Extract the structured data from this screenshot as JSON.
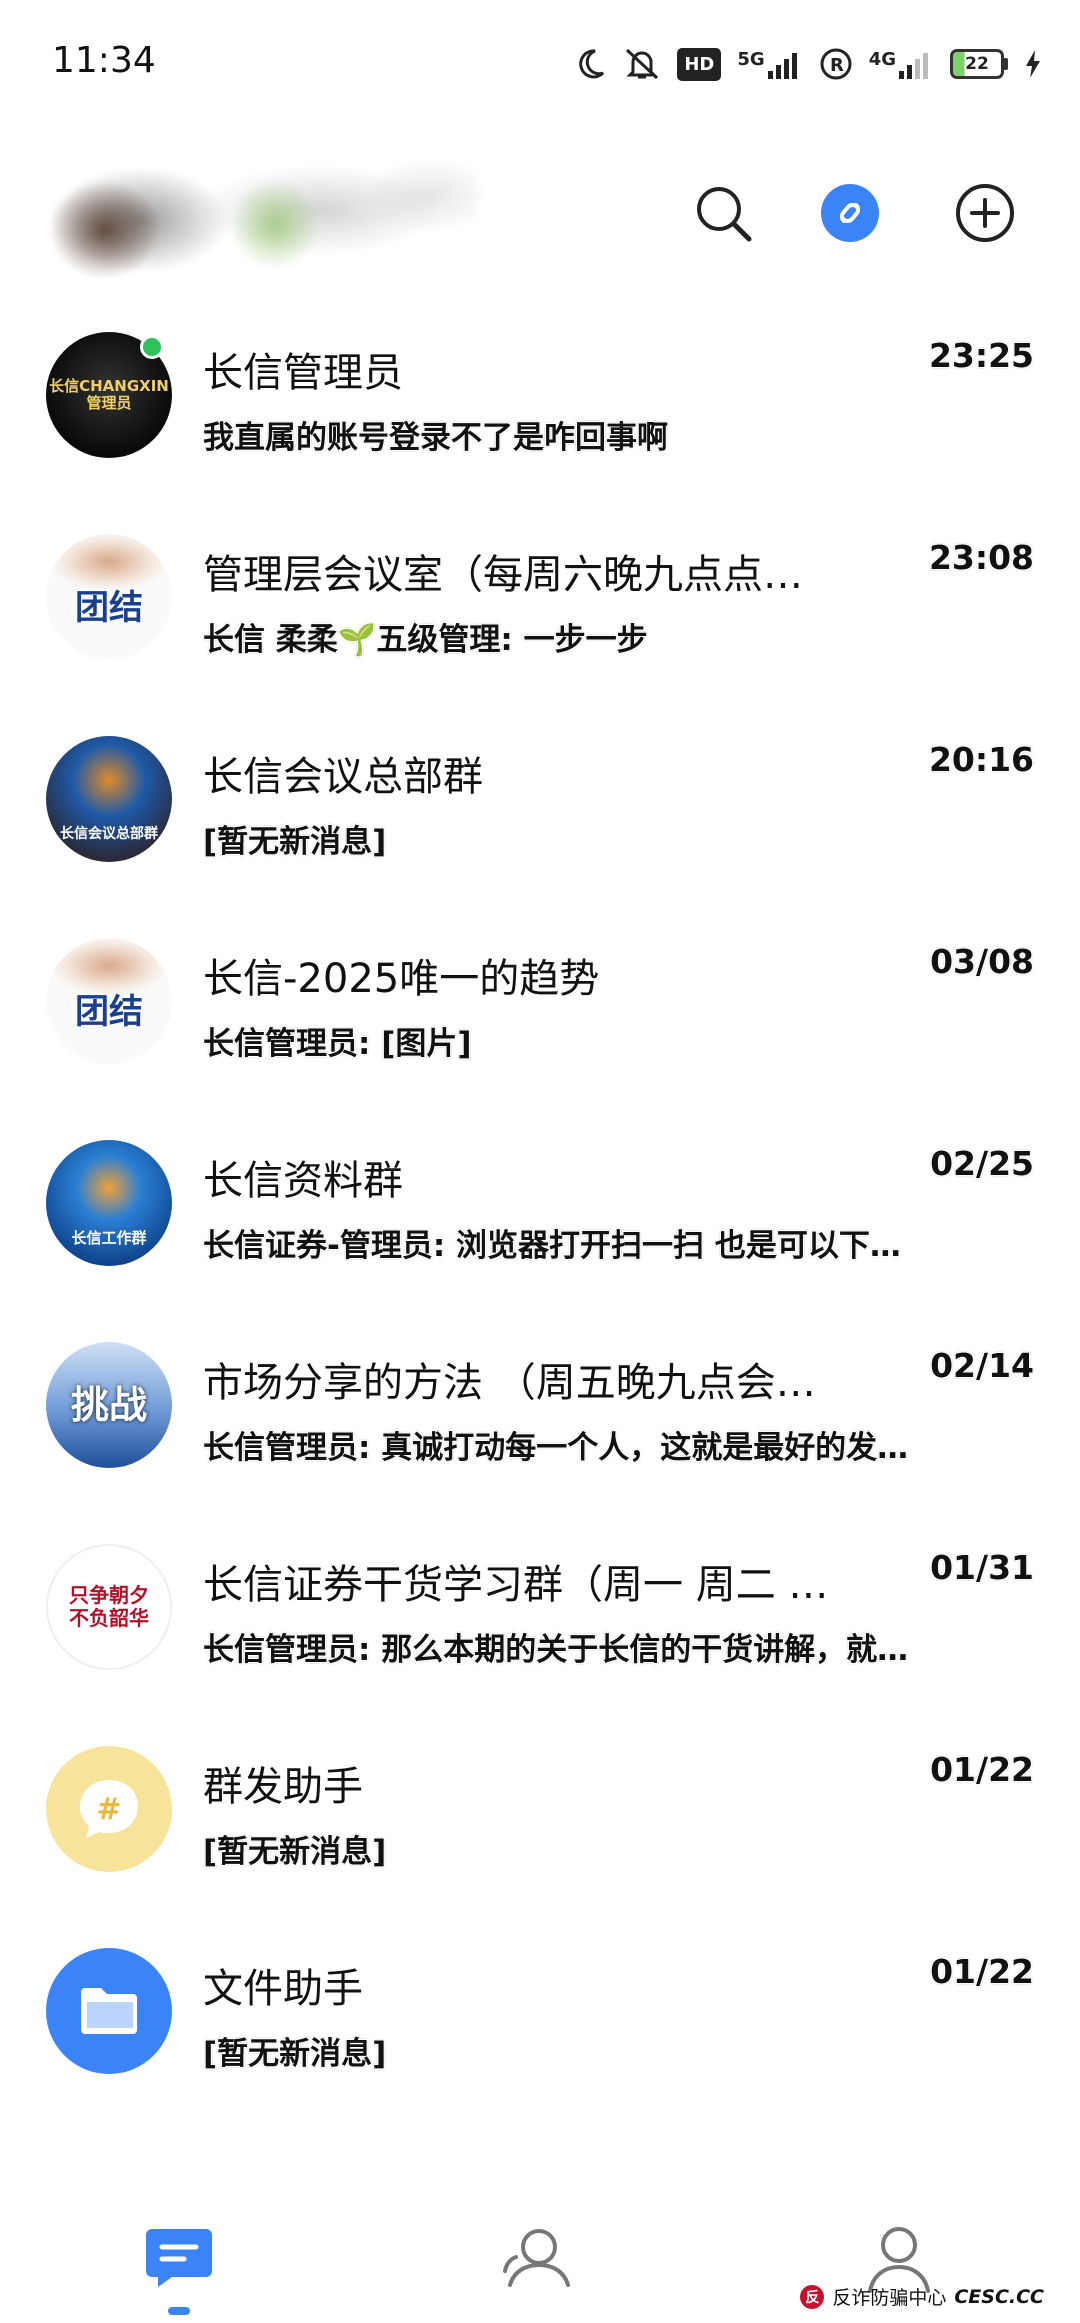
{
  "status_bar": {
    "time": "11:34",
    "hd_label": "HD",
    "net1_label": "5G",
    "net2_label": "4G",
    "battery_level": "22",
    "icons": [
      "moon-icon",
      "bell-off-icon",
      "hd-icon",
      "signal-5g-icon",
      "r-icon",
      "signal-4g-icon",
      "battery-icon",
      "charging-icon"
    ]
  },
  "header": {
    "icons": [
      "search-icon",
      "link-icon",
      "add-icon"
    ],
    "accent": "#3a84f7"
  },
  "chats": [
    {
      "name": "长信管理员",
      "time": "23:25",
      "preview": "我直属的账号登录不了是咋回事啊",
      "avatar_label": "长信CHANGXIN 管理员"
    },
    {
      "name": "管理层会议室（每周六晚九点点…",
      "time": "23:08",
      "preview": "长信 柔柔🌱五级管理: 一步一步",
      "avatar_label": "团结"
    },
    {
      "name": "长信会议总部群",
      "time": "20:16",
      "preview": "[暂无新消息]",
      "avatar_label": "长信会议总部群"
    },
    {
      "name": "长信-2025唯一的趋势",
      "time": "03/08",
      "preview": "长信管理员: [图片]",
      "avatar_label": "团结"
    },
    {
      "name": "长信资料群",
      "time": "02/25",
      "preview": "长信证券-管理员: 浏览器打开扫一扫 也是可以下…",
      "avatar_label": "长信工作群"
    },
    {
      "name": "市场分享的方法 （周五晚九点会…",
      "time": "02/14",
      "preview": "长信管理员: 真诚打动每一个人，这就是最好的发…",
      "avatar_label": "挑战"
    },
    {
      "name": "长信证券干货学习群（周一 周二 …",
      "time": "01/31",
      "preview": "长信管理员: 那么本期的关于长信的干货讲解，就…",
      "avatar_label": "只争朝夕 不负韶华"
    },
    {
      "name": "群发助手",
      "time": "01/22",
      "preview": "[暂无新消息]",
      "avatar_label": "#"
    },
    {
      "name": "文件助手",
      "time": "01/22",
      "preview": "[暂无新消息]",
      "avatar_label": ""
    }
  ],
  "tabbar": {
    "tabs": [
      {
        "name": "messages",
        "icon": "chat-icon",
        "active": true
      },
      {
        "name": "contacts",
        "icon": "contacts-icon",
        "active": false
      },
      {
        "name": "me",
        "icon": "person-icon",
        "active": false
      }
    ]
  },
  "watermark": {
    "logo": "反",
    "text": "反诈防骗中心",
    "site": "CESC.CC"
  },
  "colors": {
    "accent": "#3a84f7",
    "online": "#2ec25b",
    "group_helper": "#f5d46a",
    "file_helper": "#3a84f7"
  }
}
